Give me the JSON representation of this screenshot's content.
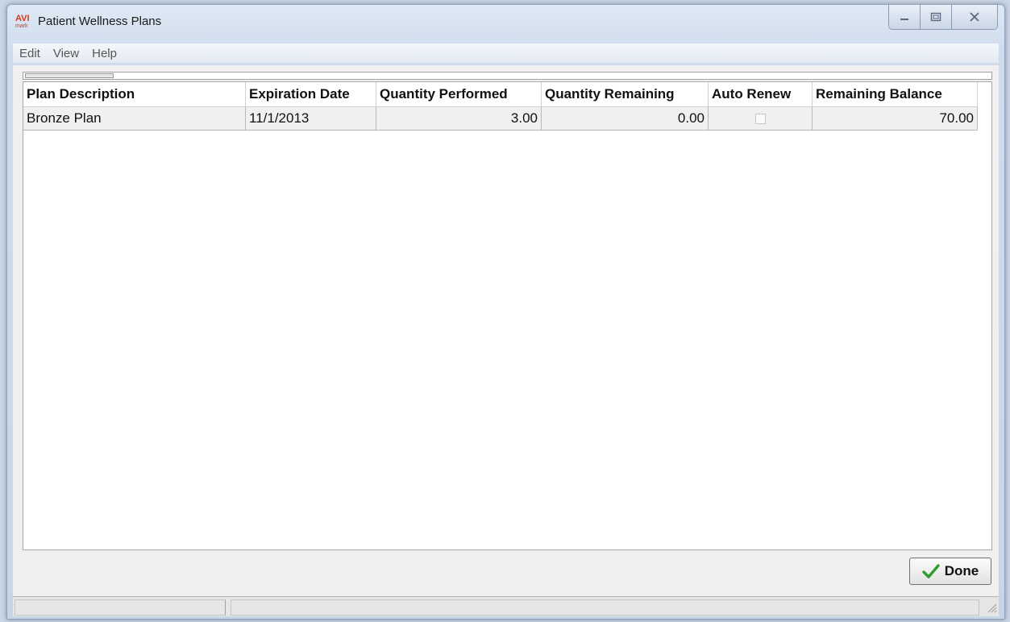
{
  "window": {
    "title": "Patient Wellness Plans",
    "logo_text": "AVI",
    "logo_sub": "mark"
  },
  "menu": {
    "items": [
      "Edit",
      "View",
      "Help"
    ]
  },
  "grid": {
    "columns": [
      "Plan Description",
      "Expiration Date",
      "Quantity Performed",
      "Quantity Remaining",
      "Auto Renew",
      "Remaining Balance"
    ],
    "rows": [
      {
        "plan_description": "Bronze Plan",
        "expiration_date": "11/1/2013",
        "quantity_performed": "3.00",
        "quantity_remaining": "0.00",
        "auto_renew": false,
        "remaining_balance": "70.00"
      }
    ]
  },
  "buttons": {
    "done_label": "Done",
    "done_icon": "checkmark-icon",
    "done_icon_color": "#2e9c2e"
  }
}
